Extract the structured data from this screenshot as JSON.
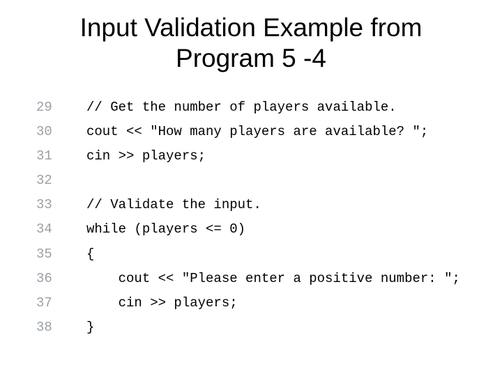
{
  "title_line1": "Input Validation Example from",
  "title_line2": "Program 5 -4",
  "code": {
    "lines": [
      {
        "no": "29",
        "text": "// Get the number of players available."
      },
      {
        "no": "30",
        "text": "cout << \"How many players are available? \";"
      },
      {
        "no": "31",
        "text": "cin >> players;"
      },
      {
        "no": "32",
        "text": ""
      },
      {
        "no": "33",
        "text": "// Validate the input."
      },
      {
        "no": "34",
        "text": "while (players <= 0)"
      },
      {
        "no": "35",
        "text": "{"
      },
      {
        "no": "36",
        "text": "    cout << \"Please enter a positive number: \";"
      },
      {
        "no": "37",
        "text": "    cin >> players;"
      },
      {
        "no": "38",
        "text": "}"
      }
    ]
  }
}
